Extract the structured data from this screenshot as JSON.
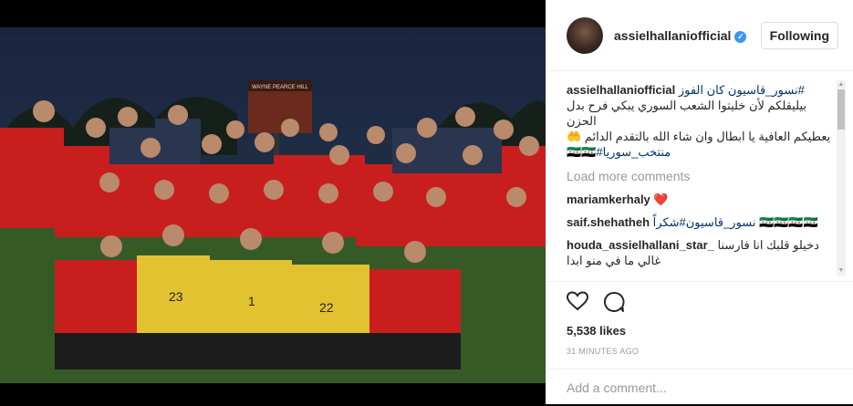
{
  "post": {
    "username": "assielhallaniofficial",
    "follow_label": "Following",
    "caption_user": "assielhallaniofficial",
    "caption_line1": "نسور_قاسيون كان الفوز#",
    "caption_line2": "بيليقلكم لأن خليتوا الشعب السوري يبكي فرح بدل الحزن",
    "caption_line3": "يعطيكم العافية يا ابطال وان شاء الله بالتقدم الدائم 🤲",
    "caption_line4": "منتخب_سوريا#🇸🇾🇸🇾",
    "load_more": "Load more comments",
    "comments": [
      {
        "user": "mariamkerhaly",
        "text": "❤️"
      },
      {
        "user": "saif.shehatheh",
        "text": "نسور_قاسيون#شكراً 🇸🇾🇸🇾🇸🇾🇸🇾"
      },
      {
        "user": "houda_assielhallani_star_",
        "text": "دخيلو قلبك انا فارسنا غالي ما في منو ابدا"
      }
    ],
    "likes": "5,538 likes",
    "time": "31 MINUTES AGO",
    "add_comment_placeholder": "Add a comment...",
    "photo_sign": "WAYNE PEARCE HILL",
    "jersey_numbers": [
      "23",
      "1",
      "22"
    ]
  },
  "colors": {
    "accent": "#3897f0",
    "red_kit": "#c81e1e",
    "yellow_kit": "#e3c231"
  },
  "icons": [
    "verified-badge-icon",
    "heart-icon",
    "comment-icon",
    "scroll-up-icon",
    "scroll-down-icon"
  ]
}
